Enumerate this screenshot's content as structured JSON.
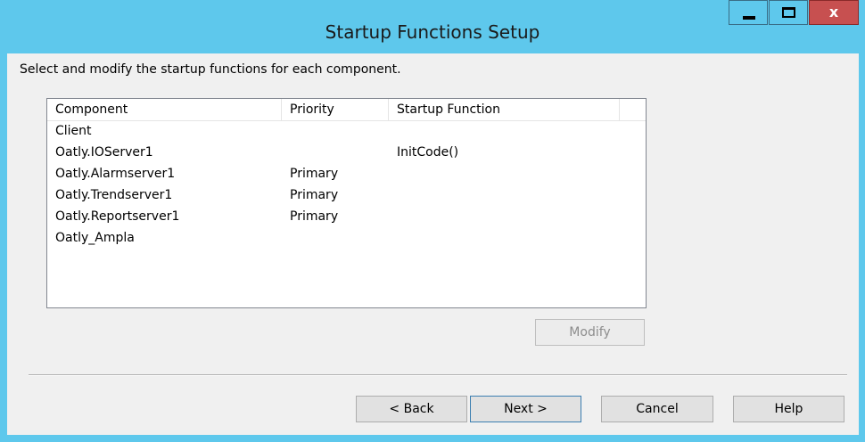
{
  "window": {
    "title": "Startup Functions Setup",
    "controls": {
      "minimize": "minimize-icon",
      "maximize": "maximize-icon",
      "close_glyph": "x"
    }
  },
  "instruction": "Select and modify the startup functions for each component.",
  "list": {
    "columns": [
      "Component",
      "Priority",
      "Startup Function"
    ],
    "rows": [
      {
        "component": "Client",
        "priority": "",
        "function": ""
      },
      {
        "component": "Oatly.IOServer1",
        "priority": "",
        "function": "InitCode()"
      },
      {
        "component": "Oatly.Alarmserver1",
        "priority": "Primary",
        "function": ""
      },
      {
        "component": "Oatly.Trendserver1",
        "priority": "Primary",
        "function": ""
      },
      {
        "component": "Oatly.Reportserver1",
        "priority": "Primary",
        "function": ""
      },
      {
        "component": "Oatly_Ampla",
        "priority": "",
        "function": ""
      }
    ]
  },
  "buttons": {
    "modify": "Modify",
    "back": "< Back",
    "next": "Next >",
    "cancel": "Cancel",
    "help": "Help"
  },
  "colors": {
    "titlebar": "#5ec8ec",
    "close": "#c75050",
    "client": "#f0f0f0"
  }
}
